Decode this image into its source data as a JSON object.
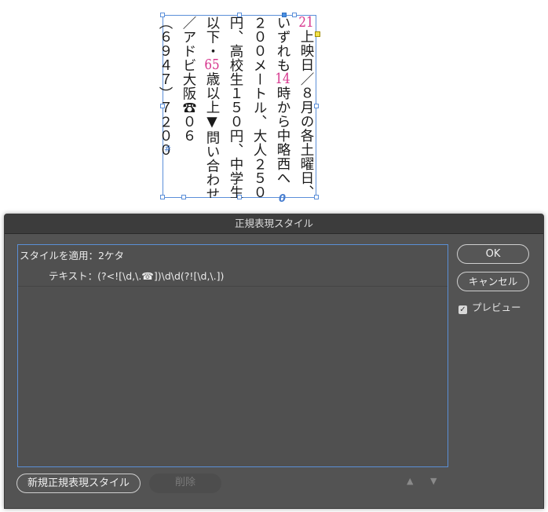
{
  "document": {
    "columns": [
      {
        "parts": [
          {
            "text": "21",
            "accent": true
          },
          {
            "text": "上映日／８月の各土曜日、"
          }
        ]
      },
      {
        "parts": [
          {
            "text": "いずれも"
          },
          {
            "text": "14",
            "accent": true
          },
          {
            "text": "時から中略西へ"
          }
        ]
      },
      {
        "parts": [
          {
            "text": "２００メートル、大人２５０"
          }
        ]
      },
      {
        "parts": [
          {
            "text": "円、高校生１５０円、中学生"
          }
        ]
      },
      {
        "parts": [
          {
            "text": "以下・"
          },
          {
            "text": "65",
            "accent": true
          },
          {
            "text": "歳以上▼問い合わせ"
          }
        ]
      },
      {
        "parts": [
          {
            "text": "／アドビ大阪☎０６"
          }
        ]
      },
      {
        "parts": [
          {
            "text": "（６９４７）７２００"
          }
        ]
      }
    ],
    "end_mark": "#",
    "overflow_mark": "0",
    "accent_color": "#d6338c"
  },
  "dialog": {
    "title": "正規表現スタイル",
    "list": {
      "apply_style_label": "スタイルを適用：2ケタ",
      "text_label": "テキスト：(?<![\\d,\\.☎])\\d\\d(?![\\d,\\.])"
    },
    "buttons": {
      "ok": "OK",
      "cancel": "キャンセル",
      "new_style": "新規正規表現スタイル",
      "delete": "削除"
    },
    "preview": {
      "label": "プレビュー",
      "checked": true,
      "check_glyph": "✓"
    },
    "arrows": {
      "up": "▲",
      "down": "▼"
    }
  }
}
